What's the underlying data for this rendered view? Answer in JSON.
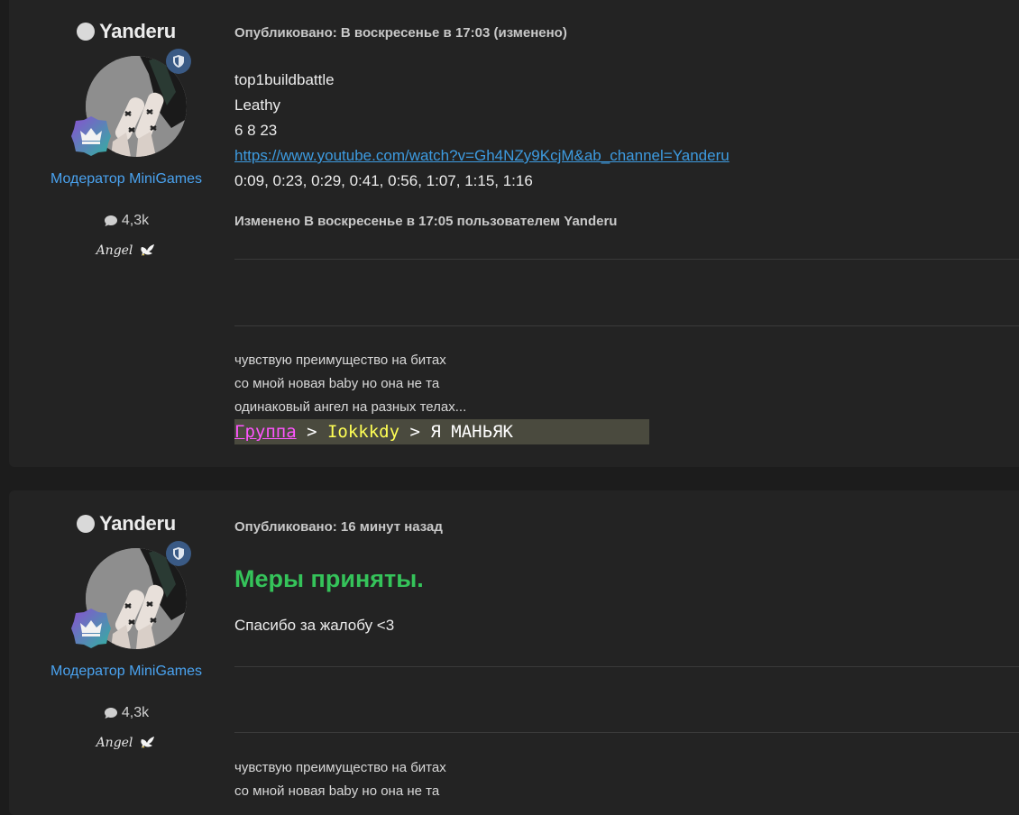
{
  "posts": [
    {
      "author": {
        "name": "Yanderu",
        "role": "Модератор MiniGames",
        "posts_count": "4,3k",
        "title": "Angel"
      },
      "meta": "Опубликовано: В воскресенье в 17:03 (изменено)",
      "lines": [
        "top1buildbattle",
        "Leathy",
        "6 8 23"
      ],
      "link": "https://www.youtube.com/watch?v=Gh4NZy9KcjM&ab_channel=Yanderu",
      "timestamps": "0:09, 0:23, 0:29, 0:41, 0:56, 1:07, 1:15, 1:16",
      "edited": "Изменено В воскресенье в 17:05 пользователем Yanderu",
      "signature": [
        "чувствую преимущество на битах",
        "со мной новая baby но она не та",
        "одинаковый ангел на разных телах..."
      ],
      "signature_image": {
        "group": "Группа",
        "sep1": " > ",
        "player": "Iokkkdy",
        "sep2": " > ",
        "message": "Я МАНЬЯК"
      }
    },
    {
      "author": {
        "name": "Yanderu",
        "role": "Модератор MiniGames",
        "posts_count": "4,3k",
        "title": "Angel"
      },
      "meta": "Опубликовано: 16 минут назад",
      "heading": "Меры приняты.",
      "text": "Спасибо за жалобу <3",
      "signature": [
        "чувствую преимущество на битах",
        "со мной новая baby но она не та"
      ]
    }
  ],
  "colors": {
    "background": "#1c1c1c",
    "panel": "#232323",
    "role": "#4aa3f0",
    "link": "#3d9be0",
    "heading_green": "#35c35a"
  }
}
